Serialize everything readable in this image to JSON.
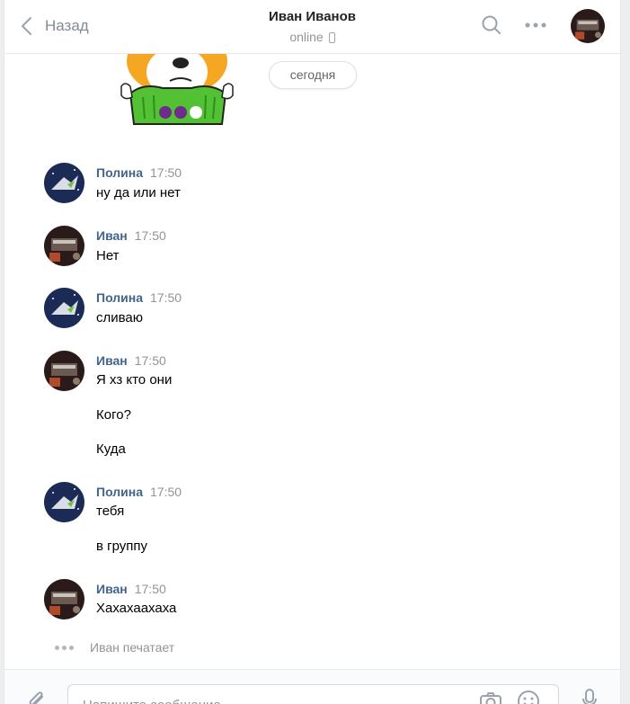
{
  "header": {
    "back_label": "Назад",
    "title": "Иван Иванов",
    "status": "online",
    "icons": [
      "chevron-left-icon",
      "search-icon",
      "more-icon",
      "phone-icon"
    ]
  },
  "chat": {
    "date_label": "сегодня",
    "messages": [
      {
        "author": "Полина",
        "time": "17:50",
        "lines": [
          "ну да или нет"
        ]
      },
      {
        "author": "Иван",
        "time": "17:50",
        "lines": [
          "Нет"
        ]
      },
      {
        "author": "Полина",
        "time": "17:50",
        "lines": [
          "сливаю"
        ]
      },
      {
        "author": "Иван",
        "time": "17:50",
        "lines": [
          "Я хз кто они",
          "Кого?",
          "Куда"
        ]
      },
      {
        "author": "Полина",
        "time": "17:50",
        "lines": [
          "тебя",
          "в группу"
        ]
      },
      {
        "author": "Иван",
        "time": "17:50",
        "lines": [
          "Хахахаахаха"
        ]
      }
    ],
    "typing": "Иван печатает"
  },
  "composer": {
    "placeholder": "Напишите сообщение...",
    "icons": [
      "paperclip-icon",
      "camera-icon",
      "smile-icon",
      "microphone-icon"
    ]
  },
  "colors": {
    "author_name": "#42648b",
    "secondary_text": "#939393",
    "sticker_green": "#52c234",
    "sticker_orange": "#f5a623",
    "sticker_purple": "#6e2c8b"
  }
}
